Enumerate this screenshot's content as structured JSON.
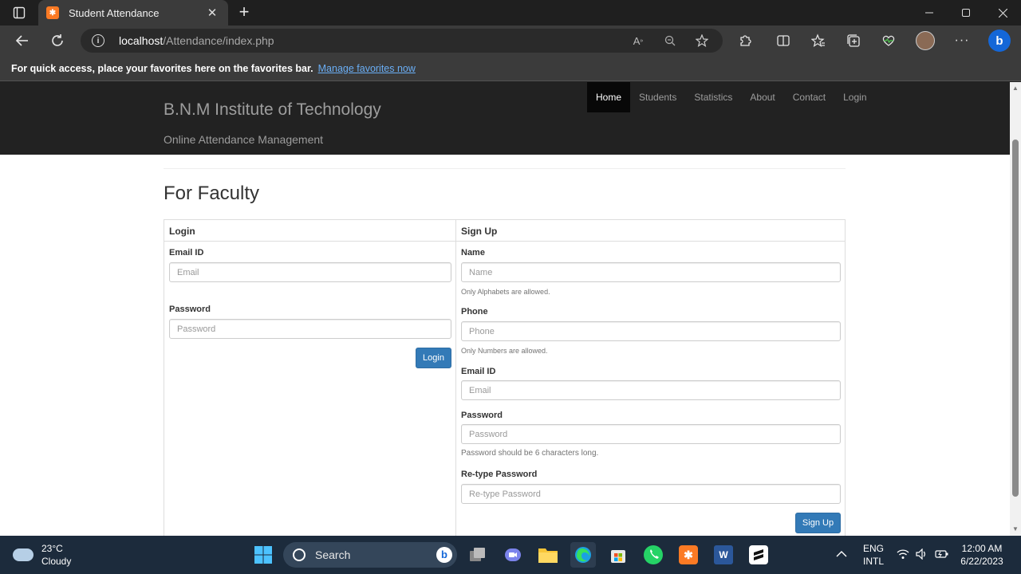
{
  "browser": {
    "tab_title": "Student Attendance",
    "tab_close": "✕",
    "new_tab": "+",
    "url_host": "localhost",
    "url_path": "/Attendance/index.php",
    "favbar_text": "For quick access, place your favorites here on the favorites bar.",
    "favbar_link": "Manage favorites now"
  },
  "site": {
    "brand": "B.N.M Institute of Technology",
    "tagline": "Online Attendance Management",
    "nav": [
      "Home",
      "Students",
      "Statistics",
      "About",
      "Contact",
      "Login"
    ],
    "active_nav": "Home"
  },
  "page": {
    "title": "For Faculty"
  },
  "login": {
    "heading": "Login",
    "email_label": "Email ID",
    "email_placeholder": "Email",
    "password_label": "Password",
    "password_placeholder": "Password",
    "button": "Login"
  },
  "signup": {
    "heading": "Sign Up",
    "name_label": "Name",
    "name_placeholder": "Name",
    "name_help": "Only Alphabets are allowed.",
    "phone_label": "Phone",
    "phone_placeholder": "Phone",
    "phone_help": "Only Numbers are allowed.",
    "email_label": "Email ID",
    "email_placeholder": "Email",
    "password_label": "Password",
    "password_placeholder": "Password",
    "password_help": "Password should be 6 characters long.",
    "retype_label": "Re-type Password",
    "retype_placeholder": "Re-type Password",
    "button": "Sign Up"
  },
  "taskbar": {
    "temp": "23°C",
    "condition": "Cloudy",
    "search": "Search",
    "lang_1": "ENG",
    "lang_2": "INTL",
    "time": "12:00 AM",
    "date": "6/22/2023"
  },
  "colors": {
    "primary_button": "#337ab7",
    "navbar_bg": "#222222",
    "taskbar_bg": "#1c2b3c"
  }
}
